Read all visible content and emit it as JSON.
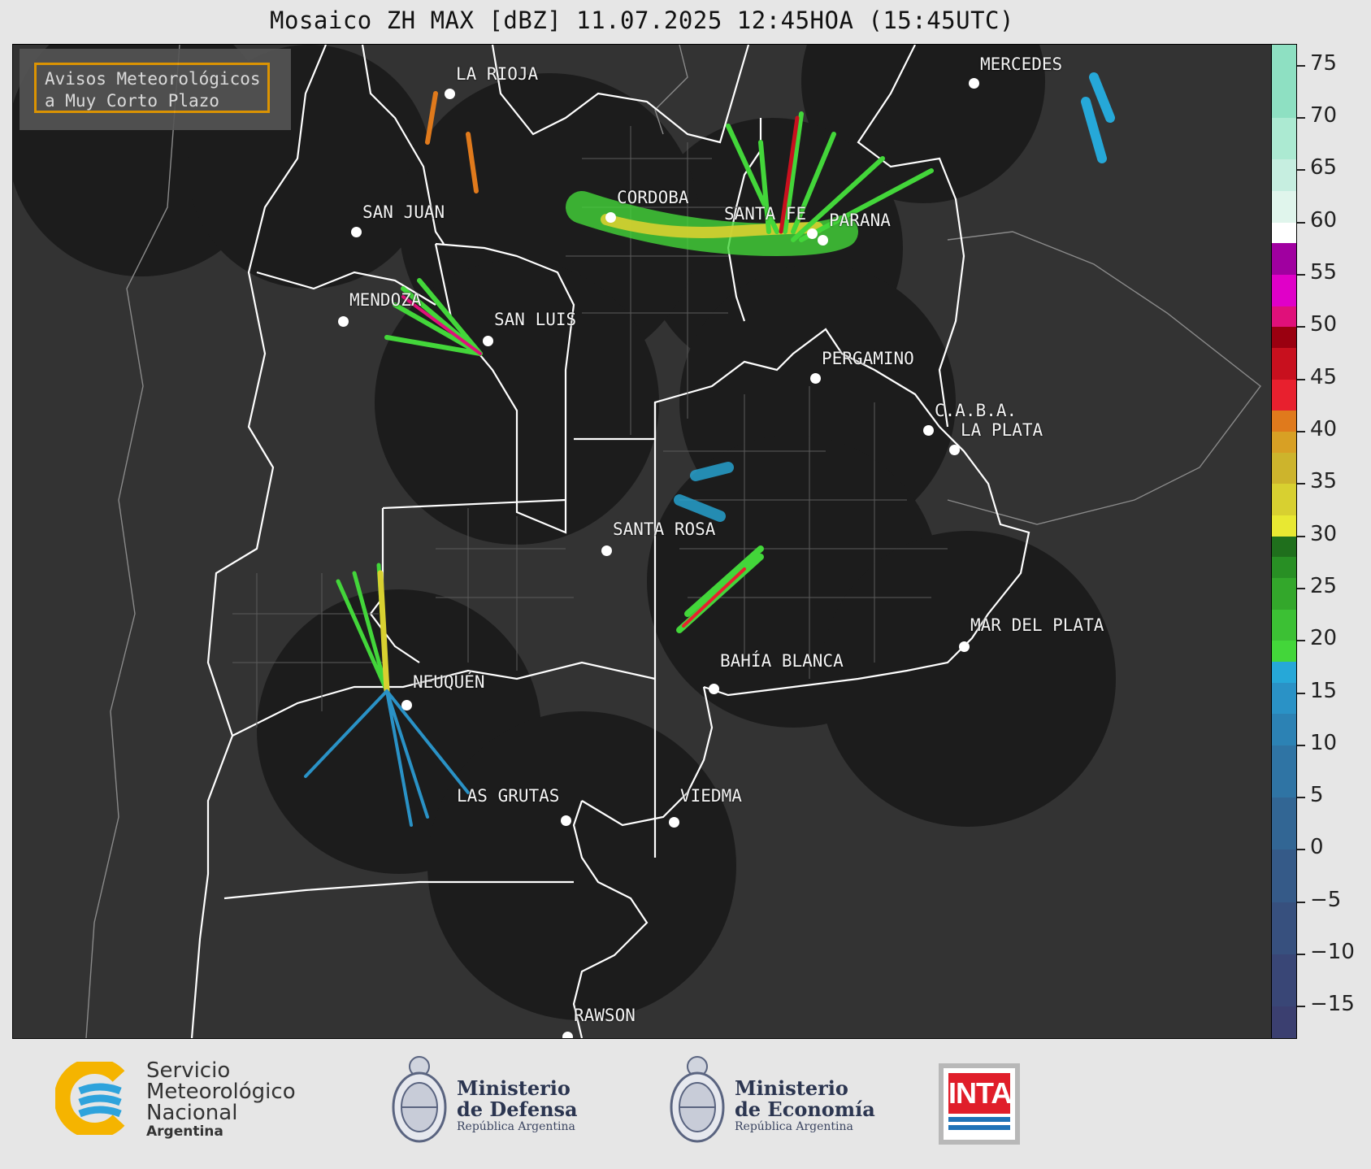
{
  "title": "Mosaico ZH MAX [dBZ] 11.07.2025 12:45HOA (15:45UTC)",
  "legend_box": {
    "line1": "Avisos Meteorológicos",
    "line2": "a Muy Corto Plazo"
  },
  "cities": [
    {
      "name": "LA RIOJA"
    },
    {
      "name": "MERCEDES"
    },
    {
      "name": "SAN JUAN"
    },
    {
      "name": "CORDOBA"
    },
    {
      "name": "SANTA FE"
    },
    {
      "name": "PARANA"
    },
    {
      "name": "MENDOZA"
    },
    {
      "name": "SAN LUIS"
    },
    {
      "name": "PERGAMINO"
    },
    {
      "name": "C.A.B.A."
    },
    {
      "name": "LA PLATA"
    },
    {
      "name": "SANTA ROSA"
    },
    {
      "name": "MAR DEL PLATA"
    },
    {
      "name": "BAHÍA BLANCA"
    },
    {
      "name": "NEUQUÉN"
    },
    {
      "name": "LAS GRUTAS"
    },
    {
      "name": "VIEDMA"
    },
    {
      "name": "RAWSON"
    }
  ],
  "colorbar": {
    "unit": "dBZ",
    "min": -18,
    "max": 77,
    "ticks": [
      "75",
      "70",
      "65",
      "60",
      "55",
      "50",
      "45",
      "40",
      "35",
      "30",
      "25",
      "20",
      "15",
      "10",
      "5",
      "0",
      "−5",
      "−10",
      "−15"
    ],
    "tick_values": [
      75,
      70,
      65,
      60,
      55,
      50,
      45,
      40,
      35,
      30,
      25,
      20,
      15,
      10,
      5,
      0,
      -5,
      -10,
      -15
    ],
    "bands": [
      {
        "from": -18,
        "to": -15,
        "color": "#3b3f70"
      },
      {
        "from": -15,
        "to": -10,
        "color": "#394676"
      },
      {
        "from": -10,
        "to": -5,
        "color": "#37507e"
      },
      {
        "from": -5,
        "to": 0,
        "color": "#355a88"
      },
      {
        "from": 0,
        "to": 5,
        "color": "#326694"
      },
      {
        "from": 5,
        "to": 10,
        "color": "#2f74a4"
      },
      {
        "from": 10,
        "to": 13,
        "color": "#2c82b4"
      },
      {
        "from": 13,
        "to": 16,
        "color": "#2a92c6"
      },
      {
        "from": 16,
        "to": 18,
        "color": "#26a8d8"
      },
      {
        "from": 18,
        "to": 20,
        "color": "#43d63a"
      },
      {
        "from": 20,
        "to": 23,
        "color": "#3cc034"
      },
      {
        "from": 23,
        "to": 26,
        "color": "#33a72b"
      },
      {
        "from": 26,
        "to": 28,
        "color": "#288f24"
      },
      {
        "from": 28,
        "to": 30,
        "color": "#1f6f1c"
      },
      {
        "from": 30,
        "to": 32,
        "color": "#e8e832"
      },
      {
        "from": 32,
        "to": 35,
        "color": "#d8d030"
      },
      {
        "from": 35,
        "to": 38,
        "color": "#cdb42c"
      },
      {
        "from": 38,
        "to": 40,
        "color": "#d8a024"
      },
      {
        "from": 40,
        "to": 42,
        "color": "#e07a1c"
      },
      {
        "from": 42,
        "to": 45,
        "color": "#e8202e"
      },
      {
        "from": 45,
        "to": 48,
        "color": "#c8101e"
      },
      {
        "from": 48,
        "to": 50,
        "color": "#9a0010"
      },
      {
        "from": 50,
        "to": 52,
        "color": "#e0107a"
      },
      {
        "from": 52,
        "to": 55,
        "color": "#e000c8"
      },
      {
        "from": 55,
        "to": 58,
        "color": "#a000a0"
      },
      {
        "from": 58,
        "to": 60,
        "color": "#ffffff"
      },
      {
        "from": 60,
        "to": 63,
        "color": "#e0f5ec"
      },
      {
        "from": 63,
        "to": 66,
        "color": "#c6eee0"
      },
      {
        "from": 66,
        "to": 70,
        "color": "#acead2"
      },
      {
        "from": 70,
        "to": 77,
        "color": "#8ee0c2"
      }
    ]
  },
  "logos": {
    "smn": {
      "line1": "Servicio",
      "line2": "Meteorológico",
      "line3": "Nacional",
      "line4": "Argentina"
    },
    "defensa": {
      "line1": "Ministerio",
      "line2": "de Defensa",
      "line3": "República Argentina"
    },
    "economia": {
      "line1": "Ministerio",
      "line2": "de Economía",
      "line3": "República Argentina"
    },
    "inta": {
      "text": "INTA"
    }
  },
  "colors": {
    "map_bg": "#333333",
    "radar_coverage": "#1c1c1c",
    "border": "#ffffff"
  }
}
